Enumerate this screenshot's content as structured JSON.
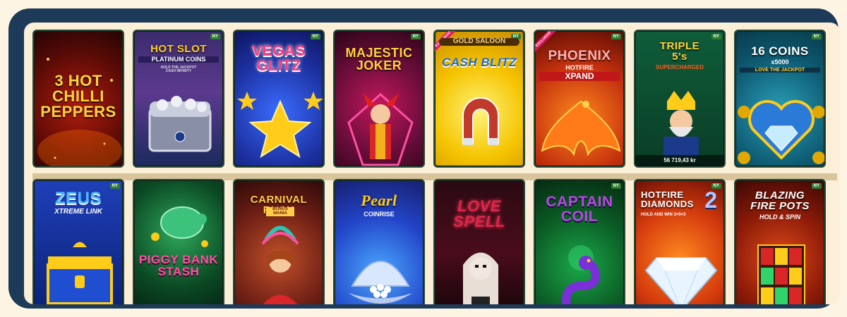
{
  "row1": [
    {
      "title": "3 HOT\nCHILLI\nPEPPERS",
      "badge": "",
      "exclusive": "",
      "sub": "",
      "jackpot": ""
    },
    {
      "title": "HOT SLOT",
      "sub": "PLATINUM COINS",
      "sub2": "HOLD THE JACKPOT\nCASH INFINITY",
      "badge": "NY",
      "exclusive": "",
      "jackpot": ""
    },
    {
      "title": "VEGAS\nGLITZ",
      "badge": "NY",
      "exclusive": "",
      "sub": "",
      "jackpot": ""
    },
    {
      "title": "MAJESTIC\nJOKER",
      "badge": "NY",
      "exclusive": "",
      "sub": "",
      "jackpot": ""
    },
    {
      "title": "CASH BLITZ",
      "sub": "GOLD SALOON",
      "badge": "NY",
      "exclusive": "EXCLUSIVE",
      "jackpot": ""
    },
    {
      "title": "PHOENIX",
      "sub": "HOTFIRE",
      "sub2": "XPAND",
      "badge": "NY",
      "exclusive": "EXCLUSIVE",
      "jackpot": ""
    },
    {
      "title": "TRIPLE\n5's",
      "sub": "SUPERCHARGED",
      "badge": "NY",
      "exclusive": "",
      "jackpot": "56 719,43 kr"
    },
    {
      "title": "16 COINS",
      "sub": "x5000",
      "sub2": "LOVE THE JACKPOT",
      "badge": "NY",
      "exclusive": "",
      "jackpot": ""
    }
  ],
  "row2": [
    {
      "title": "ZEUS",
      "sub": "XTREME LINK",
      "badge": "NY"
    },
    {
      "title": "PIGGY BANK\nSTASH",
      "badge": ""
    },
    {
      "title": "CARNIVAL RUSH",
      "sub": "BONUS MANIA",
      "badge": ""
    },
    {
      "title": "Pearl",
      "sub": "COINRISE",
      "badge": ""
    },
    {
      "title": "LOVE\nSPELL",
      "badge": ""
    },
    {
      "title": "CAPTAIN\nCOIL",
      "badge": "NY"
    },
    {
      "title": "HOTFIRE\nDIAMONDS",
      "sub": "HOLD AND WIN 3×5×3",
      "big": "2",
      "badge": "NY"
    },
    {
      "title": "BLAZING\nFIRE POTS",
      "sub": "HOLD & SPIN",
      "badge": "NY"
    }
  ],
  "colors": {
    "frame": "#1d3a58",
    "bg": "#fbefd8",
    "badge": "#2e7d32",
    "exclusive": "#e0165e"
  }
}
